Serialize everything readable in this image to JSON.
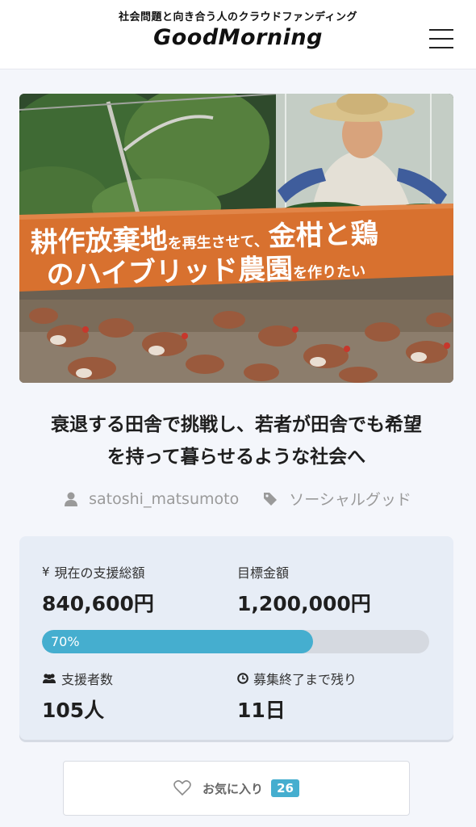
{
  "header": {
    "tagline": "社会問題と向き合う人のクラウドファンディング",
    "logo": "GoodMorning"
  },
  "hero": {
    "banner_line1_big": "耕作放棄地",
    "banner_line1_small": "を再生させて、",
    "banner_line1_big2": "金柑と鶏",
    "banner_line2_big": "のハイブリッド農園",
    "banner_line2_small": "を作りたい",
    "banner_color": "#d8712f"
  },
  "project": {
    "title_line1": "衰退する田舎で挑戦し、若者が田舎でも希望",
    "title_line2": "を持って暮らせるような社会へ",
    "author": "satoshi_matsumoto",
    "category": "ソーシャルグッド"
  },
  "stats": {
    "current_label": "現在の支援総額",
    "current_value": "840,600円",
    "target_label": "目標金額",
    "target_value": "1,200,000円",
    "progress_percent": 70,
    "progress_text": "70%",
    "supporters_label": "支援者数",
    "supporters_value": "105人",
    "remaining_label": "募集終了まで残り",
    "remaining_value": "11日",
    "yen_symbol": "¥"
  },
  "favorite": {
    "label": "お気に入り",
    "count": "26"
  },
  "colors": {
    "accent": "#45aecf",
    "banner": "#d8712f"
  }
}
